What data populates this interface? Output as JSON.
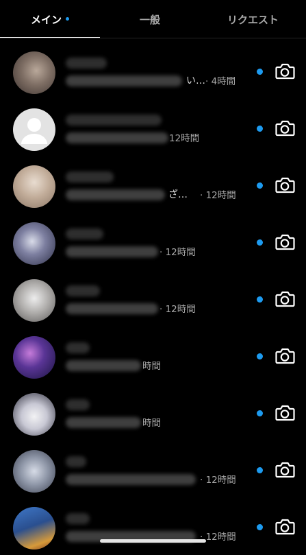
{
  "tabs": {
    "main": "メイン",
    "general": "一般",
    "requests": "リクエスト"
  },
  "threads": [
    {
      "msg_tail": "い…",
      "time": "· 4時間",
      "unread": true,
      "avatar_color": "#8a7a72"
    },
    {
      "msg_tail": "",
      "time": "12時間",
      "unread": true,
      "avatar_color": "#dcdcdc"
    },
    {
      "msg_tail": "ざ…",
      "time": "· 12時間",
      "unread": true,
      "avatar_color": "#b8a798"
    },
    {
      "msg_tail": "",
      "time": "· 12時間",
      "unread": true,
      "avatar_color": "#6b6f8c"
    },
    {
      "msg_tail": "",
      "time": "· 12時間",
      "unread": true,
      "avatar_color": "#a9a7a6"
    },
    {
      "msg_tail": "",
      "time": "時間",
      "unread": true,
      "avatar_color": "#4b2f7a"
    },
    {
      "msg_tail": "",
      "time": "時間",
      "unread": true,
      "avatar_color": "#c9c9d2"
    },
    {
      "msg_tail": "",
      "time": "· 12時間",
      "unread": true,
      "avatar_color": "#8f97a8"
    },
    {
      "msg_tail": "",
      "time": "· 12時間",
      "unread": true,
      "avatar_color": "#2d5fa8"
    }
  ],
  "colors": {
    "accent": "#1d9bf0",
    "background": "#000000",
    "secondary_text": "#a8a8a8"
  },
  "icons": {
    "camera": "camera-icon"
  }
}
